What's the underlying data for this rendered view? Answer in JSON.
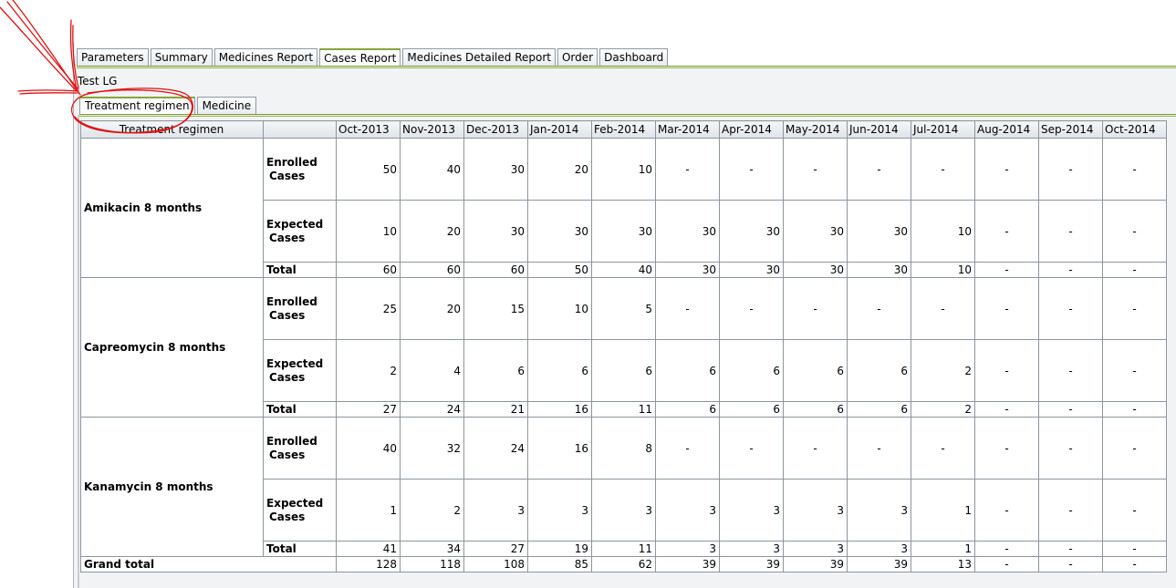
{
  "main_tabs": [
    {
      "label": "Parameters",
      "active": false
    },
    {
      "label": "Summary",
      "active": false
    },
    {
      "label": "Medicines Report",
      "active": false
    },
    {
      "label": "Cases Report",
      "active": true
    },
    {
      "label": "Medicines Detailed Report",
      "active": false
    },
    {
      "label": "Order",
      "active": false
    },
    {
      "label": "Dashboard",
      "active": false
    }
  ],
  "report_name": "Test LG",
  "sub_tabs": [
    {
      "label": "Treatment regimen",
      "active": true
    },
    {
      "label": "Medicine",
      "active": false
    }
  ],
  "table": {
    "corner_header": "Treatment regimen",
    "months": [
      "Oct-2013",
      "Nov-2013",
      "Dec-2013",
      "Jan-2014",
      "Feb-2014",
      "Mar-2014",
      "Apr-2014",
      "May-2014",
      "Jun-2014",
      "Jul-2014",
      "Aug-2014",
      "Sep-2014",
      "Oct-2014"
    ],
    "row_labels": {
      "enrolled_line1": "Enrolled",
      "enrolled_line2": "Cases",
      "expected_line1": "Expected",
      "expected_line2": "Cases",
      "total": "Total",
      "grand_total": "Grand total"
    },
    "regimens": [
      {
        "name": "Amikacin 8 months",
        "enrolled": [
          "50",
          "40",
          "30",
          "20",
          "10",
          "-",
          "-",
          "-",
          "-",
          "-",
          "-",
          "-",
          "-"
        ],
        "expected": [
          "10",
          "20",
          "30",
          "30",
          "30",
          "30",
          "30",
          "30",
          "30",
          "10",
          "-",
          "-",
          "-"
        ],
        "total": [
          "60",
          "60",
          "60",
          "50",
          "40",
          "30",
          "30",
          "30",
          "30",
          "10",
          "-",
          "-",
          "-"
        ]
      },
      {
        "name": "Capreomycin 8 months",
        "enrolled": [
          "25",
          "20",
          "15",
          "10",
          "5",
          "-",
          "-",
          "-",
          "-",
          "-",
          "-",
          "-",
          "-"
        ],
        "expected": [
          "2",
          "4",
          "6",
          "6",
          "6",
          "6",
          "6",
          "6",
          "6",
          "2",
          "-",
          "-",
          "-"
        ],
        "total": [
          "27",
          "24",
          "21",
          "16",
          "11",
          "6",
          "6",
          "6",
          "6",
          "2",
          "-",
          "-",
          "-"
        ]
      },
      {
        "name": "Kanamycin 8 months",
        "enrolled": [
          "40",
          "32",
          "24",
          "16",
          "8",
          "-",
          "-",
          "-",
          "-",
          "-",
          "-",
          "-",
          "-"
        ],
        "expected": [
          "1",
          "2",
          "3",
          "3",
          "3",
          "3",
          "3",
          "3",
          "3",
          "1",
          "-",
          "-",
          "-"
        ],
        "total": [
          "41",
          "34",
          "27",
          "19",
          "11",
          "3",
          "3",
          "3",
          "3",
          "1",
          "-",
          "-",
          "-"
        ]
      }
    ],
    "grand_total": [
      "128",
      "118",
      "108",
      "85",
      "62",
      "39",
      "39",
      "39",
      "39",
      "13",
      "-",
      "-",
      "-"
    ]
  },
  "colors": {
    "annotation": "#e01010",
    "active_tab_accent": "#86a43a"
  }
}
